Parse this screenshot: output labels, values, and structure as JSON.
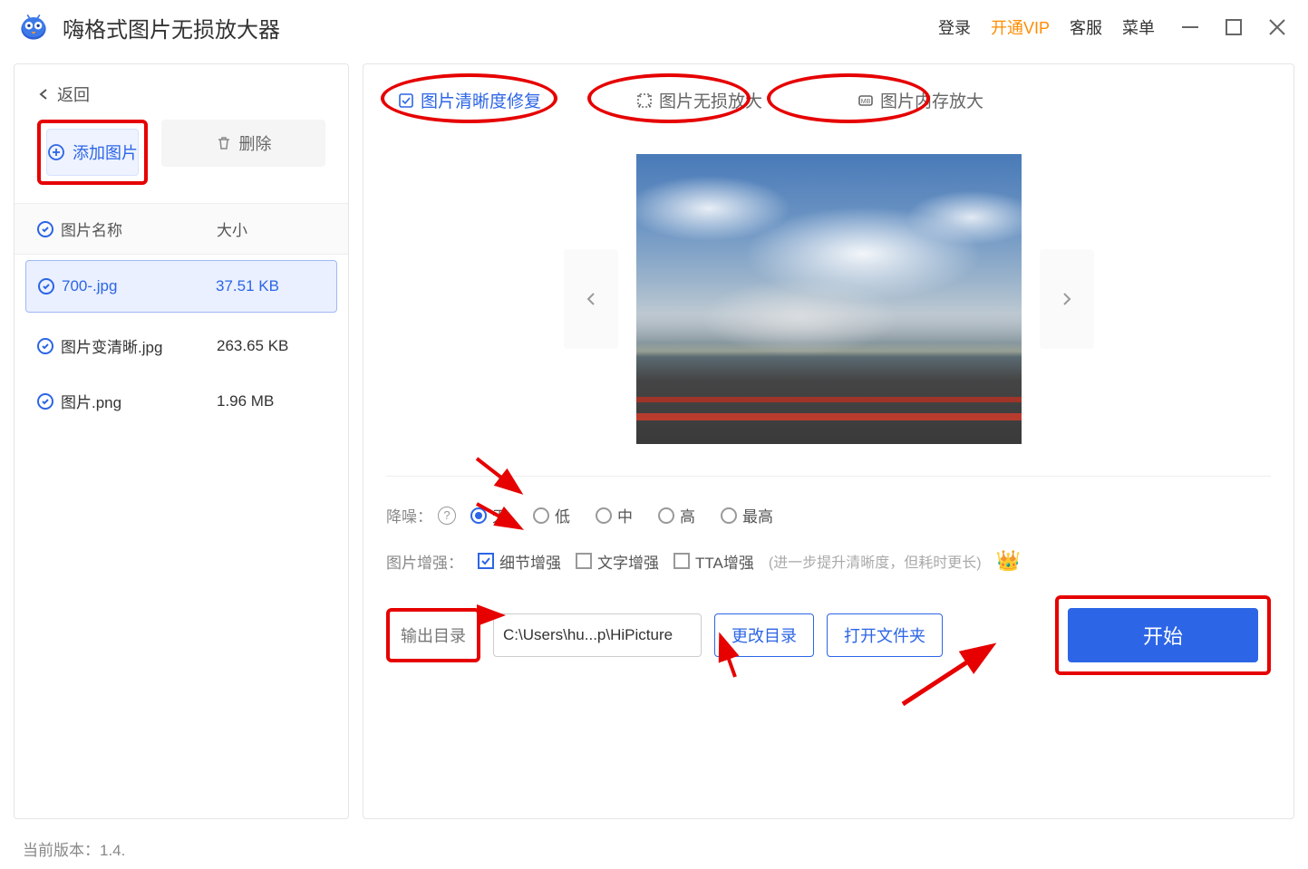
{
  "app": {
    "title": "嗨格式图片无损放大器"
  },
  "topnav": {
    "login": "登录",
    "vip": "开通VIP",
    "help": "客服",
    "menu": "菜单"
  },
  "sidebar": {
    "back": "返回",
    "add_label": "添加图片",
    "del_label": "删除",
    "col_name": "图片名称",
    "col_size": "大小",
    "files": [
      {
        "name": "700-.jpg",
        "size": "37.51 KB",
        "sel": true
      },
      {
        "name": "图片变清晰.jpg",
        "size": "263.65 KB",
        "sel": false
      },
      {
        "name": "图片.png",
        "size": "1.96 MB",
        "sel": false
      }
    ]
  },
  "tabs": [
    {
      "label": "图片清晰度修复",
      "active": true
    },
    {
      "label": "图片无损放大",
      "active": false
    },
    {
      "label": "图片内存放大",
      "active": false
    }
  ],
  "noise": {
    "label": "降噪：",
    "options": [
      "无",
      "低",
      "中",
      "高",
      "最高"
    ],
    "selected": "无"
  },
  "enhance": {
    "label": "图片增强：",
    "detail": "细节增强",
    "text": "文字增强",
    "tta": "TTA增强",
    "hint": "(进一步提升清晰度，但耗时更长)"
  },
  "output": {
    "label": "输出目录",
    "path": "C:\\Users\\hu...p\\HiPicture",
    "change": "更改目录",
    "open": "打开文件夹",
    "start": "开始"
  },
  "footer": {
    "version_label": "当前版本：",
    "version": "1.4.    "
  }
}
